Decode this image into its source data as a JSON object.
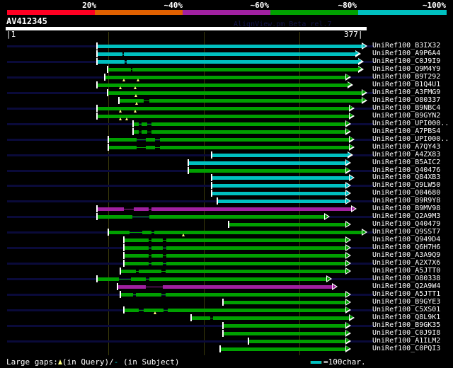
{
  "identity_scale": {
    "labels": [
      "20%",
      "~40%",
      "~60%",
      "~80%",
      "~100%"
    ],
    "colors": [
      "#ff0022",
      "#e06000",
      "#a020a0",
      "#00a000",
      "#00c0c0"
    ]
  },
  "query": {
    "name": "AV412345",
    "start_label": "|1",
    "end_label": "377|",
    "length": 377
  },
  "watermark": "AlignView.pm Beta rel.7",
  "guides": [
    100,
    200,
    300
  ],
  "hits": [
    {
      "name": "UniRef100_B3IX32",
      "start": 95,
      "end": 377,
      "color": "cyan",
      "gaps": [],
      "qgaps": []
    },
    {
      "name": "UniRef100_A9P6A4",
      "start": 95,
      "end": 370,
      "color": "cyan",
      "gaps": [
        [
          122,
          123
        ]
      ],
      "qgaps": []
    },
    {
      "name": "UniRef100_C0J9I9",
      "start": 95,
      "end": 373,
      "color": "cyan",
      "gaps": [
        [
          124,
          126
        ]
      ],
      "qgaps": []
    },
    {
      "name": "UniRef100_Q9M4Y9",
      "start": 106,
      "end": 373,
      "color": "green",
      "gaps": [
        [
          131,
          132
        ]
      ],
      "qgaps": []
    },
    {
      "name": "UniRef100_B9T292",
      "start": 103,
      "end": 360,
      "color": "green",
      "gaps": [],
      "qgaps": [
        123,
        138
      ]
    },
    {
      "name": "UniRef100_B1Q4U1",
      "start": 95,
      "end": 362,
      "color": "green",
      "gaps": [],
      "qgaps": [
        120,
        135
      ]
    },
    {
      "name": "UniRef100_A3FMG9",
      "start": 106,
      "end": 377,
      "color": "green",
      "gaps": [],
      "qgaps": [
        136
      ]
    },
    {
      "name": "UniRef100_O80337",
      "start": 118,
      "end": 377,
      "color": "green",
      "gaps": [
        [
          144,
          150
        ]
      ],
      "qgaps": [
        137
      ]
    },
    {
      "name": "UniRef100_B9NBC4",
      "start": 95,
      "end": 364,
      "color": "green",
      "gaps": [],
      "qgaps": [
        120,
        135
      ]
    },
    {
      "name": "UniRef100_B9GYN2",
      "start": 95,
      "end": 364,
      "color": "green",
      "gaps": [],
      "qgaps": [
        120,
        126
      ]
    },
    {
      "name": "UniRef100_UPI000..",
      "start": 133,
      "end": 360,
      "color": "green",
      "gaps": [
        [
          139,
          142
        ],
        [
          148,
          152
        ]
      ],
      "qgaps": []
    },
    {
      "name": "UniRef100_A7PBS4",
      "start": 133,
      "end": 360,
      "color": "green",
      "gaps": [
        [
          139,
          142
        ],
        [
          148,
          152
        ]
      ],
      "qgaps": []
    },
    {
      "name": "UniRef100_UPI000..",
      "start": 107,
      "end": 364,
      "color": "green",
      "gaps": [
        [
          137,
          146
        ],
        [
          156,
          161
        ]
      ],
      "qgaps": []
    },
    {
      "name": "UniRef100_A7QY43",
      "start": 107,
      "end": 364,
      "color": "green",
      "gaps": [
        [
          137,
          146
        ],
        [
          156,
          161
        ]
      ],
      "qgaps": []
    },
    {
      "name": "UniRef100_A4ZX83",
      "start": 215,
      "end": 362,
      "color": "cyan",
      "gaps": [],
      "qgaps": []
    },
    {
      "name": "UniRef100_B5AIC2",
      "start": 191,
      "end": 360,
      "color": "cyan",
      "gaps": [],
      "qgaps": []
    },
    {
      "name": "UniRef100_Q40476",
      "start": 191,
      "end": 360,
      "color": "green",
      "gaps": [],
      "qgaps": []
    },
    {
      "name": "UniRef100_Q84XB3",
      "start": 215,
      "end": 364,
      "color": "cyan",
      "gaps": [],
      "qgaps": []
    },
    {
      "name": "UniRef100_Q9LW50",
      "start": 215,
      "end": 360,
      "color": "cyan",
      "gaps": [],
      "qgaps": []
    },
    {
      "name": "UniRef100_O04680",
      "start": 215,
      "end": 360,
      "color": "cyan",
      "gaps": [],
      "qgaps": []
    },
    {
      "name": "UniRef100_B9R9Y8",
      "start": 221,
      "end": 360,
      "color": "cyan",
      "gaps": [],
      "qgaps": []
    },
    {
      "name": "UniRef100_B9MV98",
      "start": 95,
      "end": 366,
      "color": "purple",
      "gaps": [
        [
          123,
          134
        ],
        [
          149,
          152
        ]
      ],
      "qgaps": []
    },
    {
      "name": "UniRef100_Q2A9M3",
      "start": 95,
      "end": 338,
      "color": "green",
      "gaps": [
        [
          132,
          150
        ]
      ],
      "qgaps": []
    },
    {
      "name": "UniRef100_Q40479",
      "start": 233,
      "end": 360,
      "color": "green",
      "gaps": [],
      "qgaps": []
    },
    {
      "name": "UniRef100_Q9SST7",
      "start": 107,
      "end": 377,
      "color": "green",
      "gaps": [
        [
          129,
          143
        ],
        [
          152,
          155
        ]
      ],
      "qgaps": [
        186
      ]
    },
    {
      "name": "UniRef100_Q949D4",
      "start": 123,
      "end": 360,
      "color": "green",
      "gaps": [
        [
          149,
          152
        ],
        [
          164,
          168
        ]
      ],
      "qgaps": []
    },
    {
      "name": "UniRef100_Q6H7H6",
      "start": 123,
      "end": 360,
      "color": "green",
      "gaps": [
        [
          149,
          152
        ],
        [
          164,
          168
        ]
      ],
      "qgaps": []
    },
    {
      "name": "UniRef100_A3A9Q9",
      "start": 123,
      "end": 360,
      "color": "green",
      "gaps": [
        [
          149,
          152
        ],
        [
          164,
          168
        ]
      ],
      "qgaps": []
    },
    {
      "name": "UniRef100_A2X7X6",
      "start": 123,
      "end": 360,
      "color": "green",
      "gaps": [
        [
          149,
          152
        ],
        [
          164,
          168
        ]
      ],
      "qgaps": []
    },
    {
      "name": "UniRef100_A5JTT0",
      "start": 120,
      "end": 360,
      "color": "green",
      "gaps": [
        [
          136,
          139
        ],
        [
          163,
          167
        ]
      ],
      "qgaps": []
    },
    {
      "name": "UniRef100_O80338",
      "start": 95,
      "end": 340,
      "color": "green",
      "gaps": [
        [
          118,
          131
        ],
        [
          146,
          150
        ]
      ],
      "qgaps": []
    },
    {
      "name": "UniRef100_Q2A9W4",
      "start": 117,
      "end": 346,
      "color": "purple",
      "gaps": [
        [
          146,
          164
        ]
      ],
      "qgaps": []
    },
    {
      "name": "UniRef100_A5JTT1",
      "start": 120,
      "end": 360,
      "color": "green",
      "gaps": [
        [
          133,
          136
        ],
        [
          163,
          167
        ]
      ],
      "qgaps": []
    },
    {
      "name": "UniRef100_B9GYE3",
      "start": 227,
      "end": 360,
      "color": "green",
      "gaps": [],
      "qgaps": []
    },
    {
      "name": "UniRef100_C5XS01",
      "start": 123,
      "end": 360,
      "color": "green",
      "gaps": [
        [
          139,
          144
        ],
        [
          165,
          169
        ]
      ],
      "qgaps": [
        156
      ]
    },
    {
      "name": "UniRef100_Q8L9K1",
      "start": 194,
      "end": 364,
      "color": "green",
      "gaps": [
        [
          214,
          217
        ]
      ],
      "qgaps": []
    },
    {
      "name": "UniRef100_B9GK35",
      "start": 227,
      "end": 360,
      "color": "green",
      "gaps": [],
      "qgaps": []
    },
    {
      "name": "UniRef100_C0J9I8",
      "start": 227,
      "end": 360,
      "color": "green",
      "gaps": [],
      "qgaps": []
    },
    {
      "name": "UniRef100_A1ILM2",
      "start": 254,
      "end": 360,
      "color": "green",
      "gaps": [],
      "qgaps": []
    },
    {
      "name": "UniRef100_C0PQI3",
      "start": 224,
      "end": 360,
      "color": "green",
      "gaps": [],
      "qgaps": []
    }
  ],
  "hit_colors": {
    "cyan": "#00c0c0",
    "green": "#00a000",
    "purple": "#a020a0",
    "orange": "#e06000",
    "red": "#ff0022"
  },
  "legend": {
    "prefix": "Large gaps:",
    "query_text": "(in Query)/",
    "subject_mark": "-",
    "subject_text": " (in Subject)",
    "scale_text": "=100char."
  }
}
